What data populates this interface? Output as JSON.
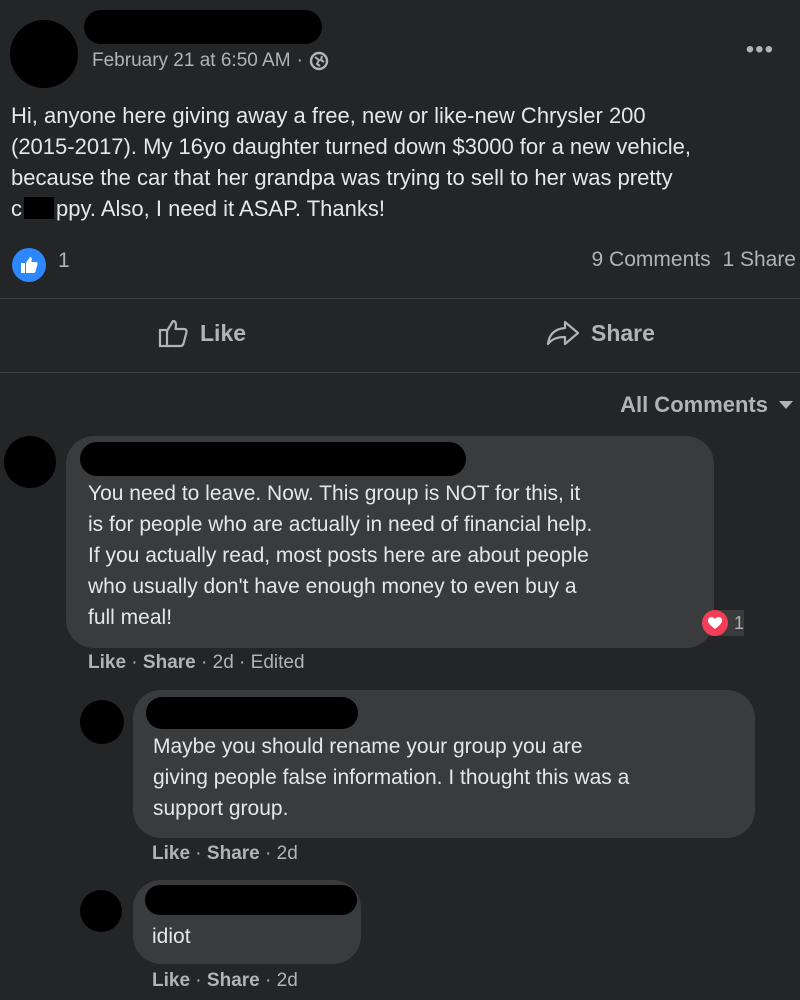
{
  "post": {
    "timestamp": "February 21 at 6:50 AM",
    "meta_separator": "·",
    "privacy_icon": "globe-icon",
    "more_icon": "more-dots-icon",
    "text_lines": [
      "Hi, anyone here giving away a free, new or like-new Chrysler 200",
      "(2015-2017). My 16yo daughter turned down $3000 for a new vehicle,",
      "because the car that her grandpa was trying to sell to her was pretty"
    ],
    "last_line_start": "c",
    "last_line_end": "ppy. Also, I need it ASAP. Thanks!",
    "reaction_count": "1",
    "comments_count": "9 Comments",
    "shares_count": "1 Share"
  },
  "actions": {
    "like_label": "Like",
    "share_label": "Share"
  },
  "filter": {
    "label": "All Comments"
  },
  "comments": [
    {
      "lines": [
        "You need to leave. Now. This group is NOT for this, it",
        "is for people who are actually in need of financial help.",
        "If you actually read, most posts here are about people",
        "who usually don't have enough money to even buy a",
        "full meal!"
      ],
      "reaction_count": "1",
      "like": "Like",
      "share": "Share",
      "time": "2d",
      "edited": "Edited"
    },
    {
      "lines": [
        "Maybe you should rename your group you are",
        "giving people false information. I thought this was a",
        "support group."
      ],
      "like": "Like",
      "share": "Share",
      "time": "2d"
    },
    {
      "lines": [
        "idiot"
      ],
      "like": "Like",
      "share": "Share",
      "time": "2d"
    }
  ],
  "colors": {
    "background": "#242526",
    "bubble": "#3a3b3c",
    "text": "#e4e6eb",
    "secondary": "#b0b3b8",
    "like_blue": "#2d88ff",
    "love_red": "#f33e58"
  }
}
